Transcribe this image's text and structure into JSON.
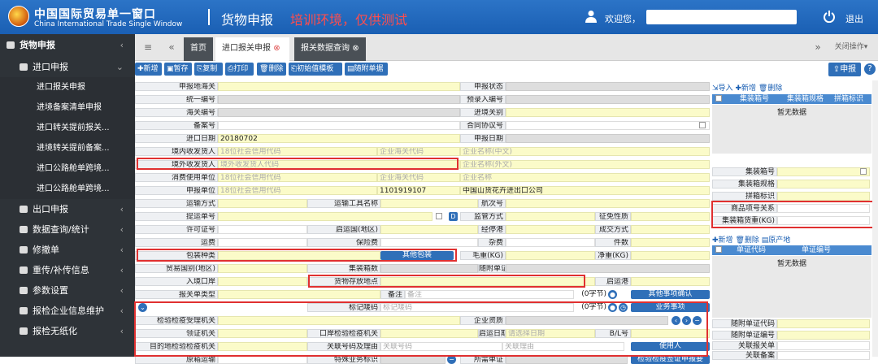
{
  "header": {
    "brand_cn": "中国国际贸易单一窗口",
    "brand_en": "China International Trade Single Window",
    "page_title": "货物申报",
    "env_note": "培训环境，仅供测试",
    "welcome": "欢迎您，",
    "logout": "退出"
  },
  "sidebar": {
    "title": "货物申报",
    "group": "进口申报",
    "items": [
      "进口报关申报",
      "进境备案清单申报",
      "进口转关提前报关...",
      "进境转关提前备案...",
      "进口公路舱单跨境...",
      "进口公路舱单跨境..."
    ],
    "sections": [
      "出口申报",
      "数据查询/统计",
      "修撤单",
      "重传/补传信息",
      "参数设置",
      "报检企业信息维护",
      "报检无纸化"
    ]
  },
  "tabs": {
    "home": "首页",
    "import": "进口报关申报",
    "query": "报关数据查询",
    "close_ops": "关闭操作"
  },
  "toolbar": {
    "new": "新增",
    "save": "暂存",
    "copy": "复制",
    "print": "打印",
    "delete": "删除",
    "init": "初始值模板",
    "attach": "随附单据",
    "declare": "申报"
  },
  "form": {
    "l_customs": "申报地海关",
    "l_status": "申报状态",
    "l_unified": "统一编号",
    "l_preentry": "预录入编号",
    "l_customs_no": "海关编号",
    "l_port": "进境关别",
    "l_record": "备案号",
    "l_contract": "合同协议号",
    "l_import_date": "进口日期",
    "v_import_date": "20180702",
    "l_declare_date": "申报日期",
    "l_consignee": "境内收发货人",
    "ph_credit": "18位社会信用代码",
    "ph_customs_code": "企业海关代码",
    "ph_name_cn": "企业名称(中文)",
    "l_foreign": "境外收发货人",
    "ph_foreign_code": "境外收发货人代码",
    "ph_name_en": "企业名称(外文)",
    "l_consumer": "消费使用单位",
    "ph_name": "企业名称",
    "l_declarer": "申报单位",
    "v_declarer_code": "1101919107",
    "v_declarer_name": "中国山货花卉进出口公司",
    "l_transport": "运输方式",
    "l_vehicle": "运输工具名称",
    "l_voyage": "航次号",
    "l_bill": "提运单号",
    "l_supervise": "监管方式",
    "l_levy": "征免性质",
    "l_license": "许可证号",
    "l_origin_country": "启运国(地区)",
    "l_via_port": "经停港",
    "l_deal": "成交方式",
    "l_freight": "运费",
    "l_insurance": "保险费",
    "l_misc": "杂费",
    "l_pieces": "件数",
    "l_package": "包装种类",
    "b_other_pack": "其他包装",
    "l_gross": "毛重(KG)",
    "l_net": "净重(KG)",
    "l_trade_country": "贸易国别(地区)",
    "l_containers": "集装箱数",
    "l_attached": "随附单证",
    "l_entry_port": "入境口岸",
    "l_goods_loc": "货物存放地点",
    "l_depart_port": "启运港",
    "l_decl_type": "报关单类型",
    "l_remark": "备注",
    "ph_remark": "备注",
    "v_bytes": "(0字节)",
    "b_other_confirm": "其他事项确认",
    "l_mark": "标记唛码",
    "ph_mark": "标记唛码",
    "b_business": "业务事项",
    "l_insp_office": "检验检疫受理机关",
    "l_qual": "企业资质",
    "l_cert_office": "领证机关",
    "l_port_insp": "口岸检验检疫机关",
    "l_depart_date": "启运日期",
    "ph_depart_date": "请选择日期",
    "l_bl": "B/L号",
    "l_dest_insp": "目的地检验检疫机关",
    "l_link_no": "关联号码及理由",
    "ph_link_no": "关联号码",
    "ph_link_reason": "关联理由",
    "b_user": "使用人",
    "l_orig_transport": "原箱运输",
    "l_special": "特殊业务标识",
    "l_required_docs": "所需单证",
    "b_insp_cert": "检验检疫签证申报要"
  },
  "right": {
    "container_tools": {
      "import": "导入",
      "new": "新增",
      "delete": "删除"
    },
    "container_cols": [
      "集装箱号",
      "集装箱规格",
      "拼箱标识"
    ],
    "empty": "暂无数据",
    "fields": {
      "container_no": "集装箱号",
      "container_spec": "集装箱规格",
      "lcl": "拼箱标识",
      "item_rel": "商品项号关系",
      "weight": "集装箱货重(KG)"
    },
    "docs_tools": {
      "new": "新增",
      "delete": "删除",
      "origin": "原产地"
    },
    "docs_cols": [
      "单证代码",
      "单证编号"
    ],
    "bottom": {
      "doc_code": "随附单证代码",
      "doc_no": "随附单证编号",
      "link_decl": "关联报关单",
      "link_record": "关联备案"
    }
  }
}
